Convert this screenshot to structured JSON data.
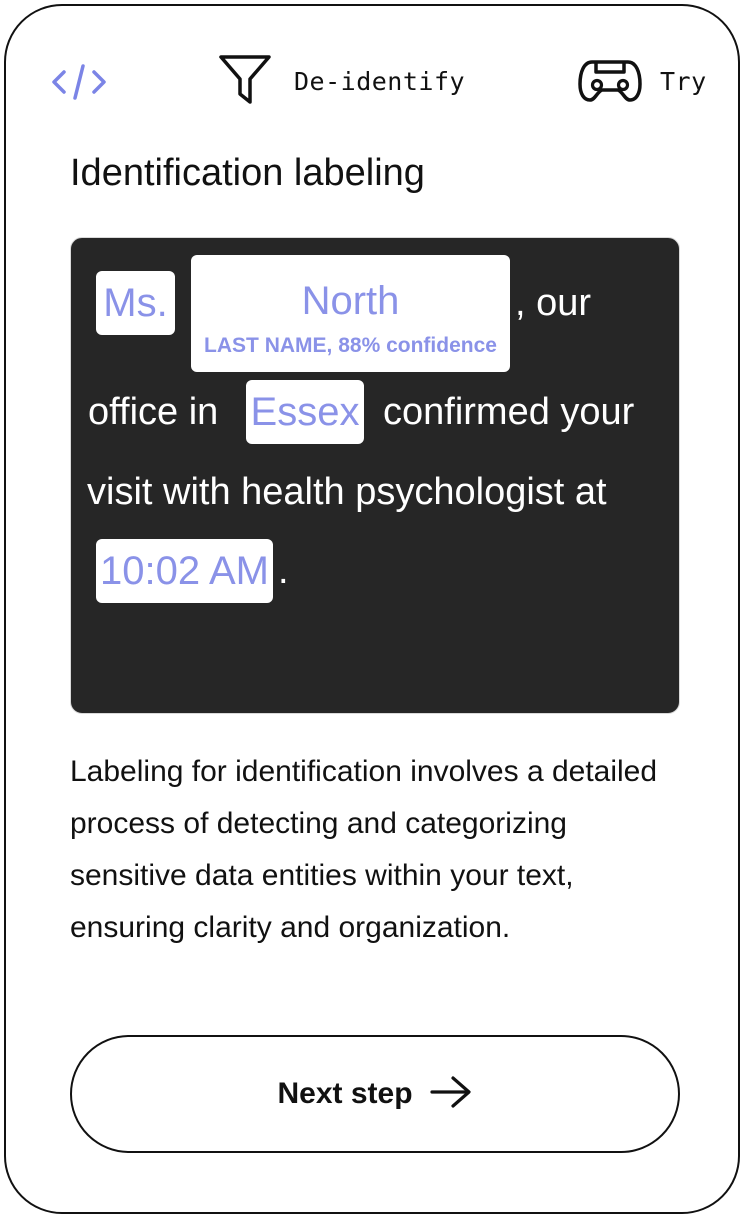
{
  "nav": {
    "code_icon": "code-icon",
    "deidentify_icon": "filter-icon",
    "deidentify_label": "De-identify",
    "try_icon": "gamepad-icon",
    "try_label": "Try"
  },
  "title": "Identification labeling",
  "example": {
    "chip_ms": "Ms.",
    "chip_north": "North",
    "chip_north_label": "LAST NAME, 88% confidence",
    "text_our": ", our",
    "text_office": "office in",
    "chip_essex": "Essex",
    "text_confirmed": "confirmed your",
    "text_visit": "visit with health psychologist at",
    "chip_time": "10:02 AM",
    "text_period": "."
  },
  "description": "Labeling for identification involves a detailed process of detecting and categorizing sensitive data entities within your text, ensuring clarity and organization.",
  "next_button": {
    "label": "Next step",
    "icon": "arrow-right-icon"
  },
  "colors": {
    "accent": "#8a92e8",
    "card_bg": "#262626",
    "text": "#111111"
  }
}
